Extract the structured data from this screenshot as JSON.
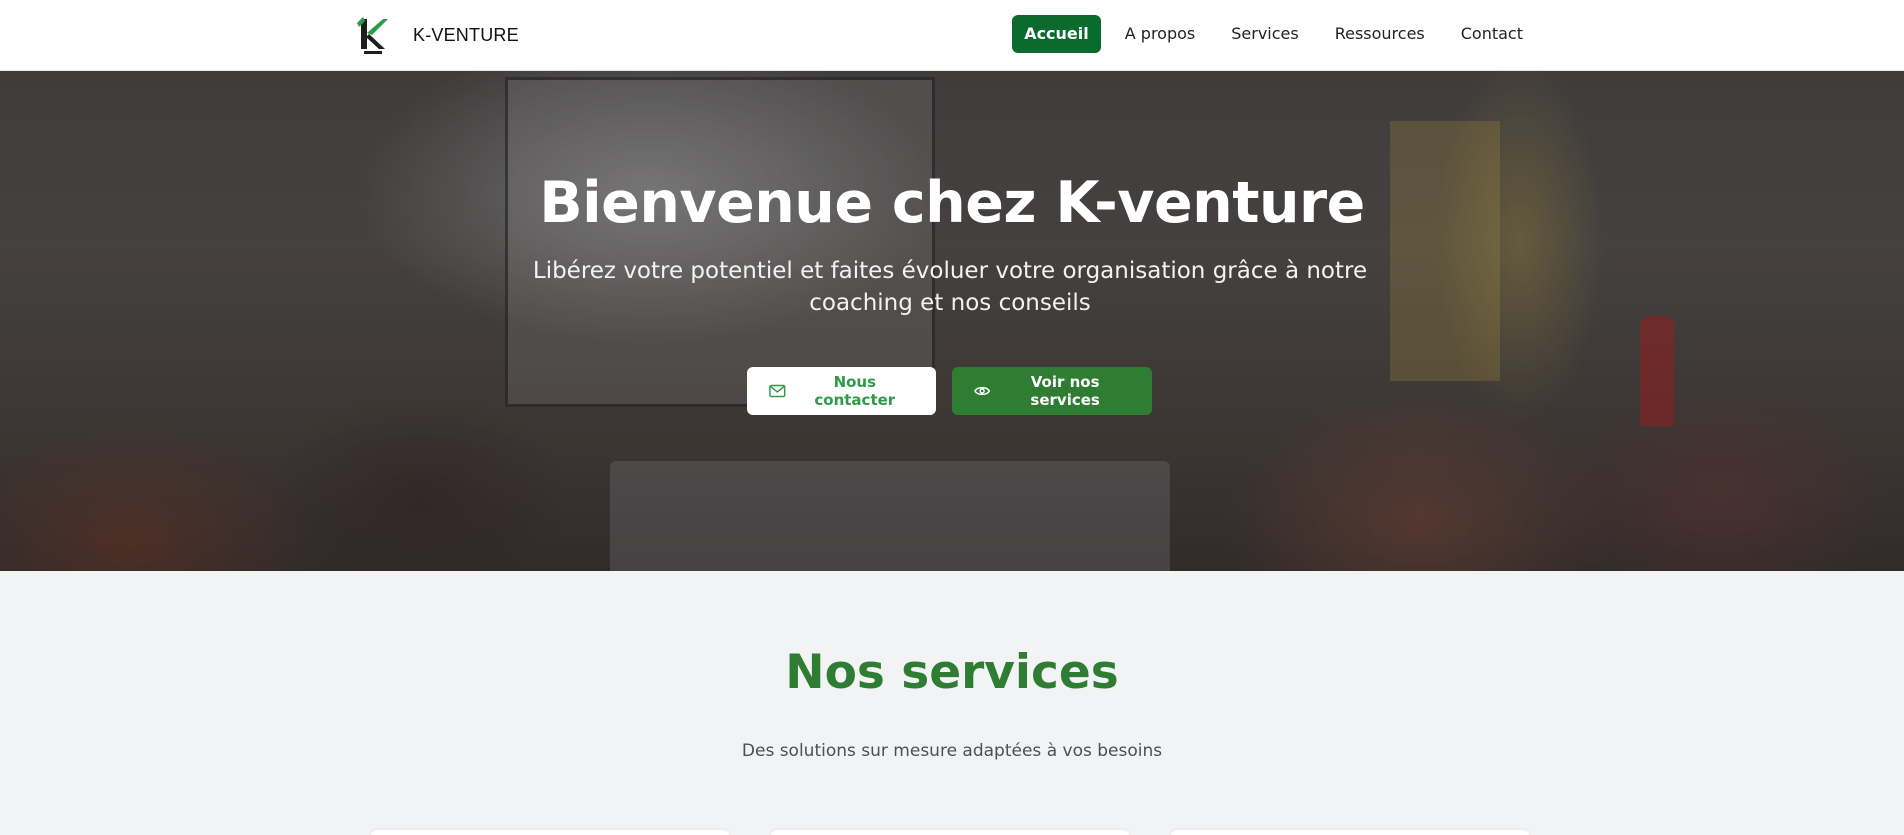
{
  "header": {
    "brand_name": "K-VENTURE",
    "logo_icon": "k-venture-logo",
    "nav": [
      {
        "label": "Accueil",
        "active": true
      },
      {
        "label": "A propos",
        "active": false
      },
      {
        "label": "Services",
        "active": false
      },
      {
        "label": "Ressources",
        "active": false
      },
      {
        "label": "Contact",
        "active": false
      }
    ]
  },
  "hero": {
    "title": "Bienvenue chez K-venture",
    "subtitle": "Libérez votre potentiel et faites évoluer votre organisation grâce à notre coaching et nos conseils",
    "buttons": {
      "contact_label": "Nous contacter",
      "contact_icon": "mail-icon",
      "services_label": "Voir nos services",
      "services_icon": "eye-icon"
    }
  },
  "services": {
    "title": "Nos services",
    "subtitle": "Des solutions sur mesure adaptées à vos besoins"
  },
  "colors": {
    "primary_green": "#2e7d32",
    "nav_active_green": "#0b6b2e",
    "contact_text_green": "#2f9a4a"
  }
}
